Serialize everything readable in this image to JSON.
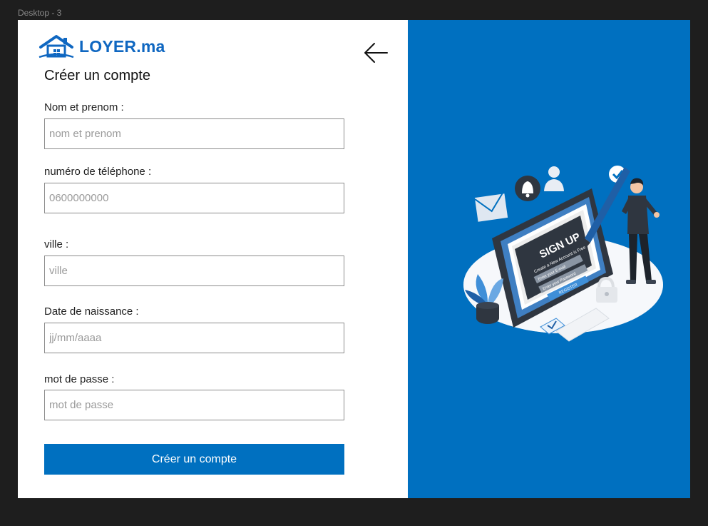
{
  "frame": {
    "label": "Desktop - 3"
  },
  "brand": {
    "name": "LOYER.ma",
    "color": "#0f67c1"
  },
  "form": {
    "title": "Créer un compte",
    "fields": [
      {
        "label": "Nom et prenom :",
        "placeholder": "nom et prenom"
      },
      {
        "label": "numéro de téléphone :",
        "placeholder": "0600000000"
      },
      {
        "label": "ville :",
        "placeholder": "ville"
      },
      {
        "label": "Date de naissance :",
        "placeholder": "jj/mm/aaaa"
      },
      {
        "label": "mot de passe :",
        "placeholder": "mot de passe"
      }
    ],
    "submit_label": "Créer un compte"
  },
  "illustration": {
    "heading": "SIGN UP",
    "subheading": "Create a New Account is Free",
    "email_placeholder": "Enter your E-mail",
    "password_placeholder": "Enter your Password",
    "button": "REGISTER"
  },
  "colors": {
    "accent": "#0070c0",
    "panel": "#0070c0",
    "background": "#1e1e1e"
  }
}
